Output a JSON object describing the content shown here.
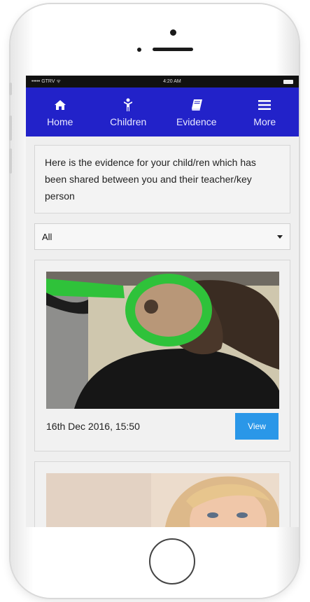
{
  "status_bar": {
    "carrier": "••••• GTRV ᯤ",
    "time": "4:20 AM",
    "battery_label": "▪"
  },
  "nav": {
    "items": [
      {
        "label": "Home",
        "icon": "home-icon"
      },
      {
        "label": "Children",
        "icon": "child-icon"
      },
      {
        "label": "Evidence",
        "icon": "book-icon"
      },
      {
        "label": "More",
        "icon": "menu-icon"
      }
    ],
    "color": "#2222c9"
  },
  "info_text": "Here is the evidence for your child/ren which has been shared between you and their teacher/key person",
  "filter": {
    "selected": "All"
  },
  "evidence": [
    {
      "date": "16th Dec 2016, 15:50",
      "button": "View"
    }
  ],
  "accent": "#2a97e8"
}
